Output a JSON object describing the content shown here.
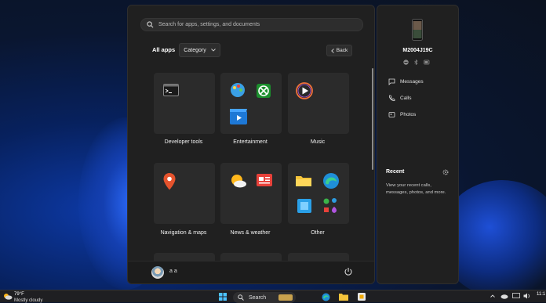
{
  "start_menu": {
    "search_placeholder": "Search for apps, settings, and documents",
    "section_title": "All apps",
    "category_label": "Category",
    "back_label": "Back",
    "tiles": [
      {
        "label": "Developer tools"
      },
      {
        "label": "Entertainment"
      },
      {
        "label": "Music"
      },
      {
        "label": "Navigation & maps"
      },
      {
        "label": "News & weather"
      },
      {
        "label": "Other"
      }
    ],
    "user_name": "a a",
    "power_icon": "power-icon"
  },
  "phone_panel": {
    "device_name": "M2004J19C",
    "links": [
      {
        "label": "Messages",
        "icon": "message-icon"
      },
      {
        "label": "Calls",
        "icon": "phone-icon"
      },
      {
        "label": "Photos",
        "icon": "photos-icon"
      }
    ],
    "recent_title": "Recent",
    "recent_description": "View your recent calls, messages, photos, and more."
  },
  "taskbar": {
    "weather_temp": "79°F",
    "weather_desc": "Mostly cloudy",
    "search_label": "Search",
    "time": "11:1"
  },
  "colors": {
    "panel_bg": "#202020",
    "tile_bg": "#2b2b2b",
    "accent_blue": "#0a5cd6"
  }
}
